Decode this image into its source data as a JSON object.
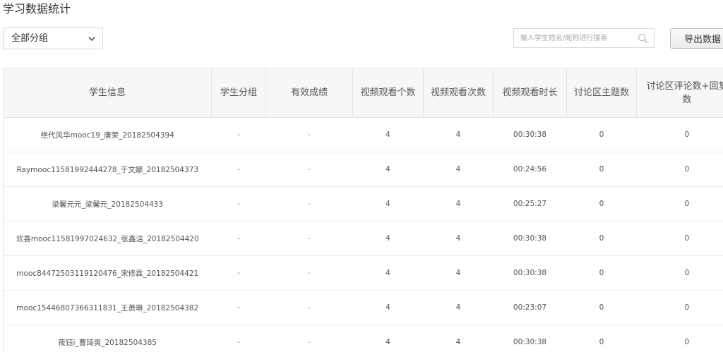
{
  "page": {
    "title": "学习数据统计"
  },
  "filter": {
    "group_label": "全部分组"
  },
  "search": {
    "placeholder": "输入学生姓名/昵称进行搜索"
  },
  "toolbar": {
    "export_label": "导出数据"
  },
  "table": {
    "headers": [
      "学生信息",
      "学生分组",
      "有效成绩",
      "视频观看个数",
      "视频观看次数",
      "视频观看时长",
      "讨论区主题数",
      "讨论区评论数+回复数"
    ],
    "rows": [
      {
        "student": "绝代风华mooc19_唐荣_20182504394",
        "group": "-",
        "score": "-",
        "video_count": "4",
        "video_views": "4",
        "video_time": "00:30:38",
        "topics": "0",
        "replies": "0"
      },
      {
        "student": "Raymooc11581992444278_于文娜_20182504373",
        "group": "-",
        "score": "-",
        "video_count": "4",
        "video_views": "4",
        "video_time": "00:24:56",
        "topics": "0",
        "replies": "0"
      },
      {
        "student": "梁馨元元_梁馨元_20182504433",
        "group": "-",
        "score": "-",
        "video_count": "4",
        "video_views": "4",
        "video_time": "00:25:27",
        "topics": "0",
        "replies": "0"
      },
      {
        "student": "欢喜mooc11581997024632_张鑫洁_20182504420",
        "group": "-",
        "score": "-",
        "video_count": "4",
        "video_views": "4",
        "video_time": "00:30:38",
        "topics": "0",
        "replies": "0"
      },
      {
        "student": "mooc84472503119120476_宋修霖_20182504421",
        "group": "-",
        "score": "-",
        "video_count": "4",
        "video_views": "4",
        "video_time": "00:30:38",
        "topics": "0",
        "replies": "0"
      },
      {
        "student": "mooc15446807366311831_王萧琳_20182504382",
        "group": "-",
        "score": "-",
        "video_count": "4",
        "video_views": "4",
        "video_time": "00:23:07",
        "topics": "0",
        "replies": "0"
      },
      {
        "student": "筱钰i_曹琦爽_20182504385",
        "group": "-",
        "score": "-",
        "video_count": "4",
        "video_views": "4",
        "video_time": "00:30:38",
        "topics": "0",
        "replies": "0"
      }
    ]
  },
  "icons": {
    "dropdown": "chevron-down-icon",
    "search": "search-icon"
  },
  "colors": {
    "header_bg": "#f7f7f7",
    "score_text": "#5fa8b8",
    "border": "#e4e4e4"
  }
}
